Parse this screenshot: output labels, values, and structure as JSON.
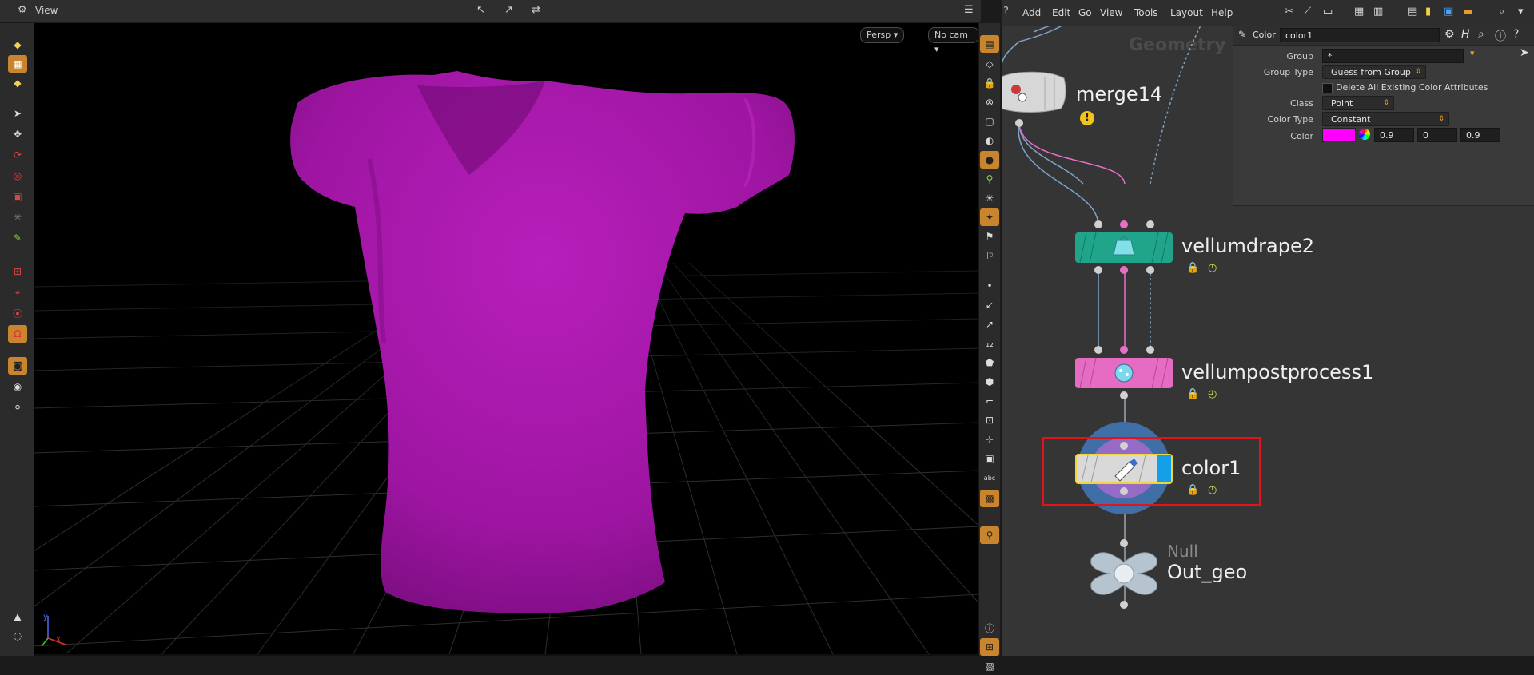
{
  "viewport": {
    "title": "View",
    "persp_label": "Persp",
    "cam_label": "No cam",
    "axis_x": "x",
    "axis_y": "y",
    "shirt_color": "#a317a6"
  },
  "menu": {
    "items": [
      "Add",
      "Edit",
      "Go",
      "View",
      "Tools",
      "Layout",
      "Help"
    ]
  },
  "network": {
    "context_label": "Geometry",
    "nodes": {
      "merge": {
        "name": "merge14"
      },
      "drape": {
        "name": "vellumdrape2",
        "color": "#20a58a"
      },
      "post": {
        "name": "vellumpostprocess1",
        "color": "#e56bc3"
      },
      "color": {
        "name": "color1"
      },
      "null": {
        "type_label": "Null",
        "name": "Out_geo"
      }
    }
  },
  "params": {
    "node_type": "Color",
    "node_name": "color1",
    "group_label": "Group",
    "group_value": "*",
    "group_type_label": "Group Type",
    "group_type_value": "Guess from Group",
    "delete_attrs_label": "Delete All Existing Color Attributes",
    "class_label": "Class",
    "class_value": "Point",
    "color_type_label": "Color Type",
    "color_type_value": "Constant",
    "color_label": "Color",
    "color_swatch": "#ff00ff",
    "color_r": "0.9",
    "color_g": "0",
    "color_b": "0.9"
  }
}
